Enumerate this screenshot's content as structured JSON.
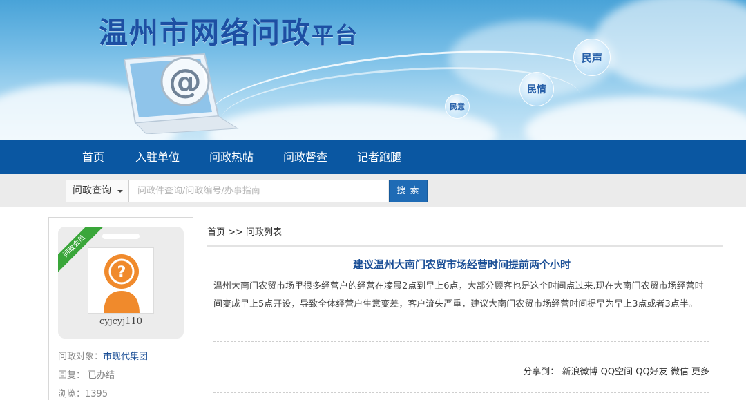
{
  "banner": {
    "title_main": "温州市网络问政",
    "title_small": "平台",
    "bubbles": [
      "民声",
      "民情",
      "民意"
    ]
  },
  "nav": {
    "items": [
      "首页",
      "入驻单位",
      "问政热帖",
      "问政督查",
      "记者跑腿"
    ]
  },
  "search": {
    "type_label": "问政查询",
    "placeholder": "问政件查询/问政编号/办事指南",
    "button_label": "搜 索"
  },
  "sidebar": {
    "badge": "问政会员",
    "username": "cyjcyj110",
    "target_label": "问政对象：",
    "target_value": "市现代集团",
    "reply_label": "回复：",
    "reply_value": "已办结",
    "views_label": "浏览：",
    "views_value": "1395"
  },
  "main": {
    "breadcrumb": "首页 >> 问政列表",
    "title": "建议温州大南门农贸市场经营时间提前两个小时",
    "body": "温州大南门农贸市场里很多经营户的经营在凌晨2点到早上6点，大部分顾客也是这个时间点过来.现在大南门农贸市场经营时间变成早上5点开设，导致全体经营户生意变差，客户流失严重，建议大南门农贸市场经营时间提早为早上3点或者3点半。",
    "share_label": "分享到：",
    "share_links": [
      "新浪微博",
      "QQ空间",
      "QQ好友",
      "微信",
      "更多"
    ]
  },
  "colors": {
    "nav_bg": "#0a57a2",
    "title_blue": "#1a4e96",
    "search_button": "#1f6bb5",
    "badge_green": "#3aa63a",
    "avatar_orange": "#f08a2c"
  }
}
